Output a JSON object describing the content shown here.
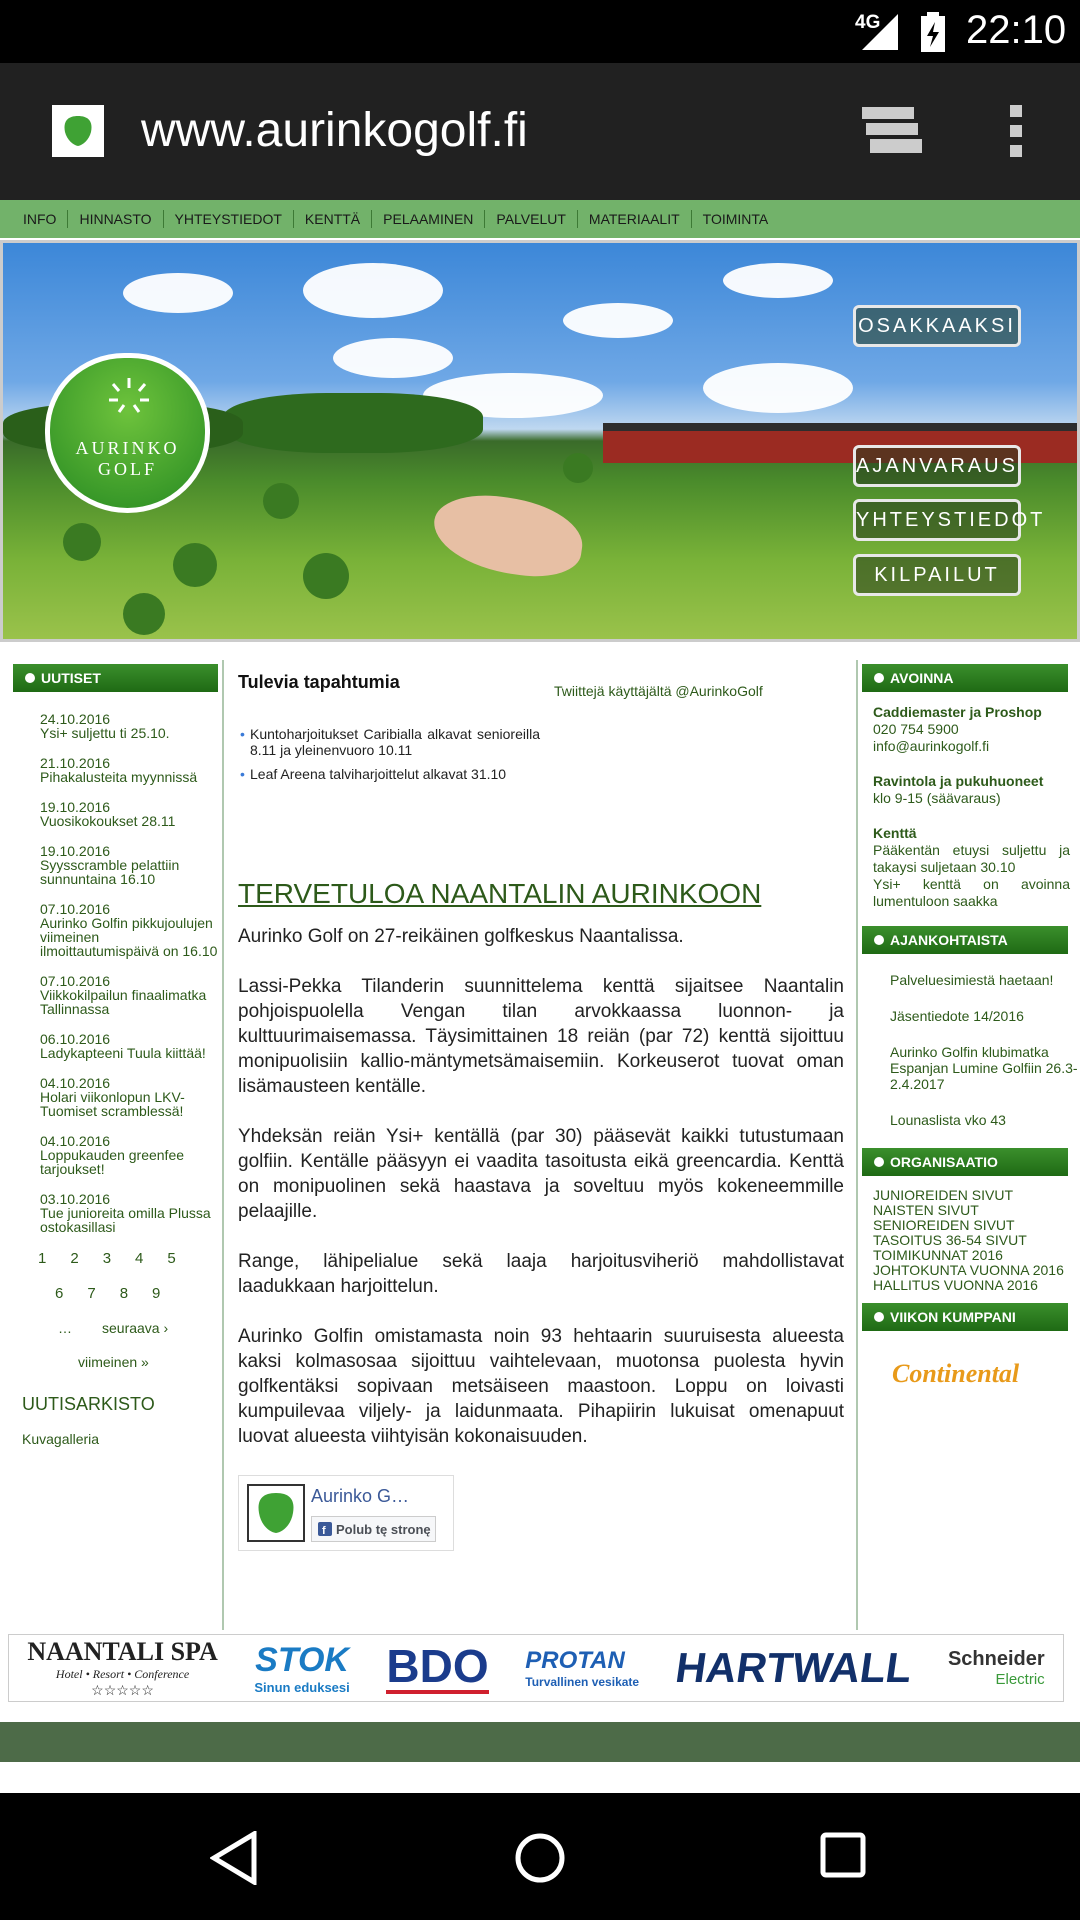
{
  "status": {
    "network": "4G",
    "time": "22:10"
  },
  "browser": {
    "url": "www.aurinkogolf.fi"
  },
  "topnav": [
    "INFO",
    "HINNASTO",
    "YHTEYSTIEDOT",
    "KENTTÄ",
    "PELAAMINEN",
    "PALVELUT",
    "MATERIAALIT",
    "TOIMINTA"
  ],
  "hero": {
    "logo_line1": "AURINKO",
    "logo_line2": "GOLF",
    "buttons": [
      "OSAKKAAKSI",
      "AJANVARAUS",
      "YHTEYSTIEDOT",
      "KILPAILUT"
    ]
  },
  "left": {
    "uutiset_title": "UUTISET",
    "news": [
      {
        "date": "24.10.2016",
        "title": "Ysi+ suljettu ti 25.10."
      },
      {
        "date": "21.10.2016",
        "title": "Pihakalusteita myynnissä"
      },
      {
        "date": "19.10.2016",
        "title": "Vuosikokoukset 28.11"
      },
      {
        "date": "19.10.2016",
        "title": "Syysscramble pelattiin sunnuntaina 16.10"
      },
      {
        "date": "07.10.2016",
        "title": "Aurinko Golfin pikkujoulujen viimeinen ilmoittautumispäivä on 16.10"
      },
      {
        "date": "07.10.2016",
        "title": "Viikkokilpailun finaalimatka Tallinnassa"
      },
      {
        "date": "06.10.2016",
        "title": "Ladykapteeni Tuula kiittää!"
      },
      {
        "date": "04.10.2016",
        "title": "Holari viikonlopun LKV-Tuomiset scramblessä!"
      },
      {
        "date": "04.10.2016",
        "title": "Loppukauden greenfee tarjoukset!"
      },
      {
        "date": "03.10.2016",
        "title": "Tue junioreita omilla Plussa ostokasillasi"
      }
    ],
    "pager": {
      "row1": [
        "1",
        "2",
        "3",
        "4",
        "5"
      ],
      "row2": [
        "6",
        "7",
        "8",
        "9"
      ],
      "ellipsis": "…",
      "next": "seuraava ›",
      "last": "viimeinen »"
    },
    "archive": "UUTISARKISTO",
    "gallery": "Kuvagalleria"
  },
  "main": {
    "events_title": "Tulevia tapahtumia",
    "twitter": "Twiittejä käyttäjältä @AurinkoGolf",
    "events": [
      "Kuntoharjoitukset Caribialla alkavat senioreilla 8.11 ja yleinenvuoro 10.11",
      "Leaf Areena talviharjoittelut alkavat 31.10"
    ],
    "heading": "TERVETULOA NAANTALIN AURINKOON",
    "paragraphs": [
      "Aurinko Golf on 27-reikäinen golfkeskus Naantalissa.",
      "Lassi-Pekka Tilanderin suunnittelema kenttä sijaitsee Naantalin pohjoispuolella Vengan tilan arvokkaassa luonnon- ja kulttuurimaisemassa. Täysimittainen 18 reiän (par 72) kenttä sijoittuu monipuolisiin kallio-mäntymetsämaisemiin. Korkeuserot tuovat oman lisämausteen kentälle.",
      "Yhdeksän reiän Ysi+ kentällä (par 30) pääsevät kaikki tutustumaan golfiin. Kentälle pääsyyn ei vaadita tasoitusta eikä greencardia. Kenttä on monipuolinen sekä haastava ja soveltuu myös kokeneemmille pelaajille.",
      "Range, lähipelialue sekä laaja harjoitusviheriö mahdollistavat laadukkaan harjoittelun.",
      "Aurinko Golfin omistamasta noin 93 hehtaarin suuruisesta alueesta kaksi kolmasosaa sijoittuu vaihtelevaan, muotonsa puolesta hyvin golfkentäksi sopivaan metsäiseen maastoon. Loppu on loivasti kumpuilevaa viljely- ja laidunmaata. Pihapiirin lukuisat omenapuut luovat alueesta viihtyisän kokonaisuuden."
    ],
    "fb_name": "Aurinko G…",
    "fb_like": "Polub tę stronę"
  },
  "right": {
    "avoinna_title": "AVOINNA",
    "caddie_title": "Caddiemaster ja Proshop",
    "phone": "020 754 5900",
    "email": "info@aurinkogolf.fi",
    "ravintola_title": "Ravintola ja pukuhuoneet",
    "ravintola_hours": "klo 9-15 (säävaraus)",
    "kentta_title": "Kenttä",
    "kentta_text1": "Pääkentän etuysi suljettu ja takaysi suljetaan 30.10",
    "kentta_text2": "Ysi+ kenttä on avoinna lumentuloon saakka",
    "ajankoht_title": "AJANKOHTAISTA",
    "ajankoht": [
      "Palveluesimiestä haetaan!",
      "Jäsentiedote 14/2016",
      "Aurinko Golfin klubimatka Espanjan Lumine Golfiin 26.3-2.4.2017",
      "Lounaslista vko 43"
    ],
    "org_title": "ORGANISAATIO",
    "org": [
      "JUNIOREIDEN SIVUT",
      "NAISTEN SIVUT",
      "SENIOREIDEN SIVUT",
      "TASOITUS 36-54 SIVUT",
      "TOIMIKUNNAT 2016",
      "JOHTOKUNTA VUONNA 2016",
      "HALLITUS VUONNA 2016"
    ],
    "partner_title": "VIIKON KUMPPANI",
    "partner": "Continental"
  },
  "sponsors": {
    "naantali": "NAANTALI SPA",
    "naantali_sub": "Hotel • Resort • Conference",
    "naantali_stars": "☆☆☆☆☆",
    "stok": "STOK",
    "stok_sub": "Sinun eduksesi",
    "bdo": "BDO",
    "protan": "PROTAN",
    "protan_sub": "Turvallinen vesikate",
    "hartwall": "HARTWALL",
    "schneider": "Schneider",
    "schneider_sub": "Electric"
  },
  "colors": {
    "accent_green": "#72b26a",
    "bar_green": "#2a7a1e",
    "link_green": "#2d5a1a"
  }
}
